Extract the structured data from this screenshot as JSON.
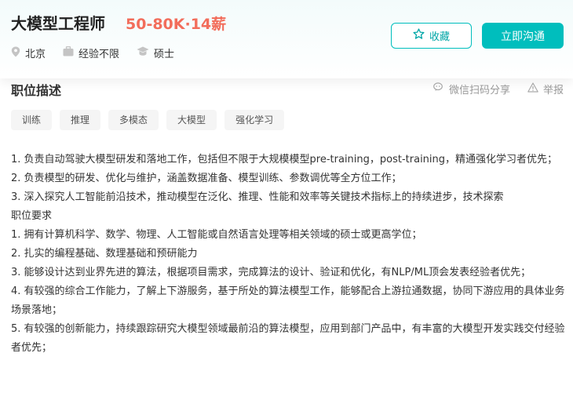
{
  "job": {
    "title": "大模型工程师",
    "salary": "50-80K·14薪",
    "location": "北京",
    "experience": "经验不限",
    "degree": "硕士"
  },
  "actions": {
    "favorite_label": "收藏",
    "chat_label": "立即沟通"
  },
  "section": {
    "title": "职位描述",
    "share_label": "微信扫码分享",
    "report_label": "举报"
  },
  "tags": [
    "训练",
    "推理",
    "多模态",
    "大模型",
    "强化学习"
  ],
  "description_lines": [
    "1. 负责自动驾驶大模型研发和落地工作，包括但不限于大规模模型pre-training，post-training，精通强化学习者优先；",
    "2. 负责模型的研发、优化与维护，涵盖数据准备、模型训练、参数调优等全方位工作；",
    "3. 深入探究人工智能前沿技术，推动模型在泛化、推理、性能和效率等关键技术指标上的持续进步，技术探索",
    "职位要求",
    "1. 拥有计算机科学、数学、物理、人工智能或自然语言处理等相关领域的硕士或更高学位；",
    "2. 扎实的编程基础、数理基础和预研能力",
    "3. 能够设计达到业界先进的算法，根据项目需求，完成算法的设计、验证和优化，有NLP/ML顶会发表经验者优先；",
    "4. 有较强的综合工作能力，了解上下游服务，基于所处的算法模型工作，能够配合上游拉通数据，协同下游应用的具体业务场景落地；",
    "5. 有较强的创新能力，持续跟踪研究大模型领域最前沿的算法模型，应用到部门产品中，有丰富的大模型开发实践交付经验者优先；"
  ],
  "colors": {
    "accent": "#00bebd",
    "salary": "#f26d5b"
  }
}
